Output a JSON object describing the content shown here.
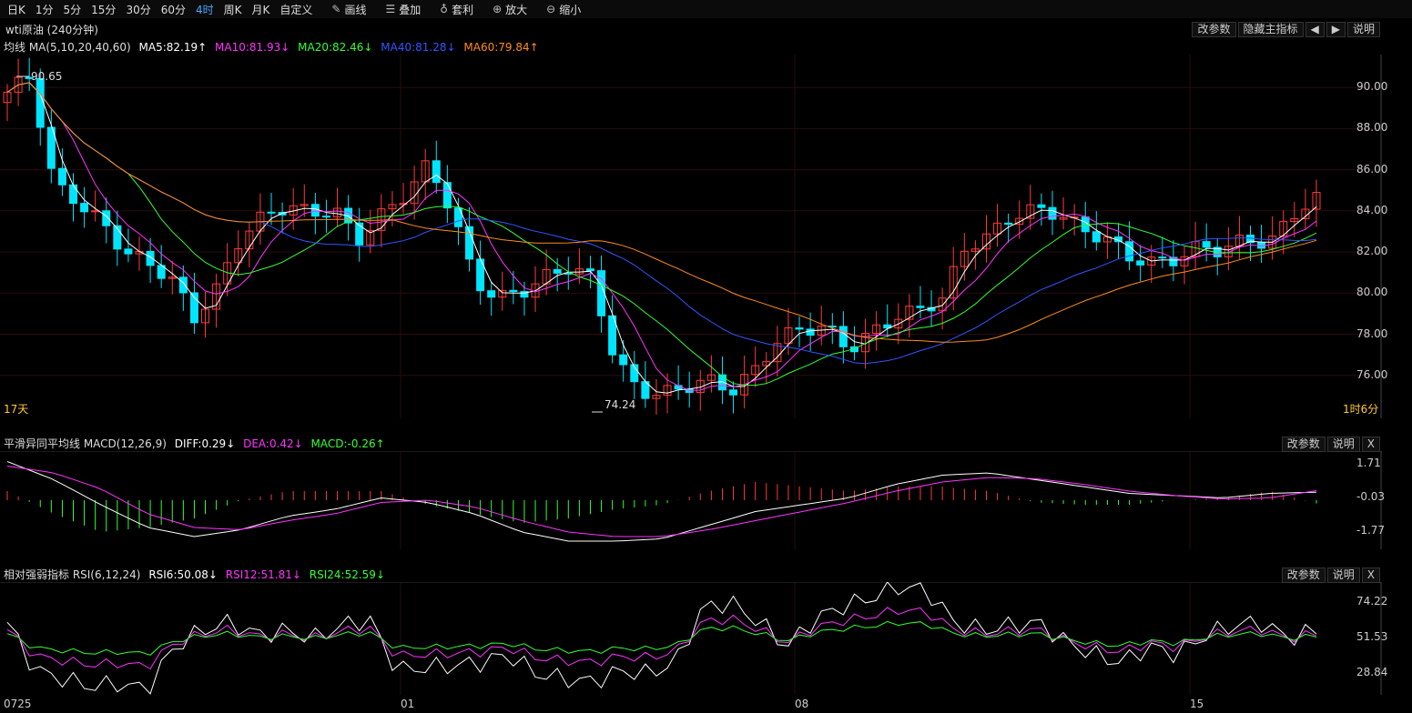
{
  "toolbar": {
    "periods": [
      "日K",
      "1分",
      "5分",
      "15分",
      "30分",
      "60分",
      "4时",
      "周K",
      "月K",
      "自定义"
    ],
    "active_period": "4时",
    "tools": [
      {
        "icon": "pencil-icon",
        "label": "画线"
      },
      {
        "icon": "layers-icon",
        "label": "叠加"
      },
      {
        "icon": "money-bag-icon",
        "label": "套利"
      },
      {
        "icon": "zoom-in-icon",
        "label": "放大"
      },
      {
        "icon": "zoom-out-icon",
        "label": "缩小"
      }
    ]
  },
  "symbol_title": "wti原油 (240分钟)",
  "main_buttons": {
    "params": "改参数",
    "hide": "隐藏主指标",
    "left": "◀",
    "right": "▶",
    "help": "说明"
  },
  "ma_legend": {
    "name": "均线 MA(5,10,20,40,60)",
    "ma5": "MA5:82.19↑",
    "ma10": "MA10:81.93↓",
    "ma20": "MA20:82.46↓",
    "ma40": "MA40:81.28↓",
    "ma60": "MA60:79.84↑"
  },
  "colors": {
    "up": "#ff3b3b",
    "down": "#00e5ff",
    "ma5": "#ffffff",
    "ma10": "#ff33ff",
    "ma20": "#33ff33",
    "ma40": "#3355ff",
    "ma60": "#ff8c1a",
    "grid": "#2a0a0a"
  },
  "price_axis": [
    "90.00",
    "88.00",
    "86.00",
    "84.00",
    "82.00",
    "80.00",
    "78.00",
    "76.00"
  ],
  "main_annotations": {
    "high": "90.65",
    "low": "74.24",
    "left_label": "17天",
    "right_label": "1时6分"
  },
  "macd": {
    "name": "平滑异同平均线 MACD(12,26,9)",
    "diff": "DIFF:0.29↓",
    "dea": "DEA:0.42↓",
    "macd": "MACD:-0.26↑",
    "params": "改参数",
    "help": "说明",
    "close": "X",
    "axis": [
      "1.71",
      "-0.03",
      "-1.77"
    ]
  },
  "rsi": {
    "name": "相对强弱指标 RSI(6,12,24)",
    "rsi6": "RSI6:50.08↓",
    "rsi12": "RSI12:51.81↓",
    "rsi24": "RSI24:52.59↓",
    "params": "改参数",
    "help": "说明",
    "close": "X",
    "axis": [
      "74.22",
      "51.53",
      "28.84"
    ]
  },
  "date_axis": [
    "0725",
    "01",
    "08",
    "15"
  ]
}
